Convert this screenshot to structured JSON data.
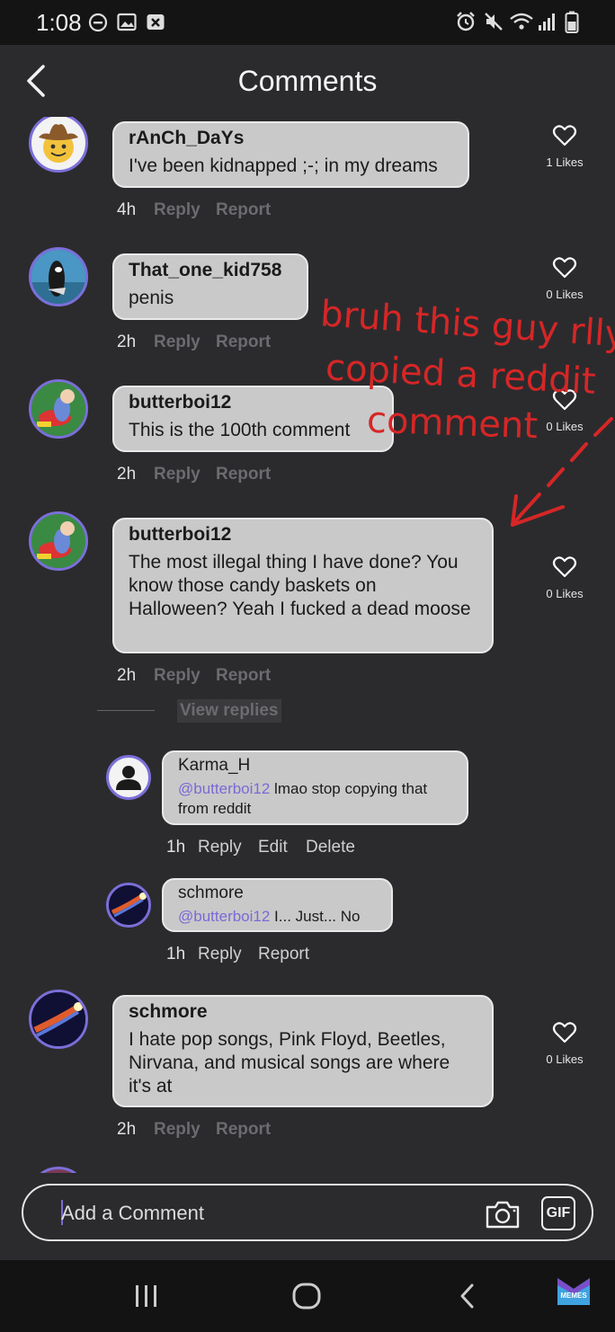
{
  "status_bar": {
    "time": "1:08"
  },
  "header": {
    "title": "Comments"
  },
  "comments": [
    {
      "username": "rAnCh_DaYs",
      "text": "I've been kidnapped ;-; in my dreams",
      "time": "4h",
      "reply": "Reply",
      "report": "Report",
      "likes": "1 Likes"
    },
    {
      "username": "That_one_kid758",
      "text": "penis",
      "time": "2h",
      "reply": "Reply",
      "report": "Report",
      "likes": "0 Likes"
    },
    {
      "username": "butterboi12",
      "text": "This is the 100th comment",
      "time": "2h",
      "reply": "Reply",
      "report": "Report",
      "likes": "0 Likes"
    },
    {
      "username": "butterboi12",
      "text": "The most illegal thing I have done? You know those candy baskets on Halloween? Yeah I fucked a dead moose",
      "time": "2h",
      "reply": "Reply",
      "report": "Report",
      "likes": "0 Likes"
    },
    {
      "username": "schmore",
      "text": "I hate pop songs, Pink Floyd, Beetles, Nirvana, and musical songs are where it's at",
      "time": "2h",
      "reply": "Reply",
      "report": "Report",
      "likes": "0 Likes"
    }
  ],
  "view_replies": "View replies",
  "replies": [
    {
      "username": "Karma_H",
      "mention": "@butterboi12",
      "text": " lmao stop copying that from reddit",
      "time": "1h",
      "reply": "Reply",
      "edit": "Edit",
      "delete": "Delete"
    },
    {
      "username": "schmore",
      "mention": "@butterboi12",
      "text": " I... Just... No",
      "time": "1h",
      "reply": "Reply",
      "report": "Report"
    }
  ],
  "annotation": {
    "line1": "bruh this guy rlly",
    "line2": "copied a reddit",
    "line3": "comment",
    "color": "#d62626"
  },
  "composer": {
    "placeholder": "Add a Comment",
    "gif_label": "GIF"
  },
  "nav": {
    "logo_text": "MEMES"
  },
  "colors": {
    "background": "#2b2b2e",
    "bubble": "#c9c9c9",
    "accent": "#7a6ad6"
  }
}
